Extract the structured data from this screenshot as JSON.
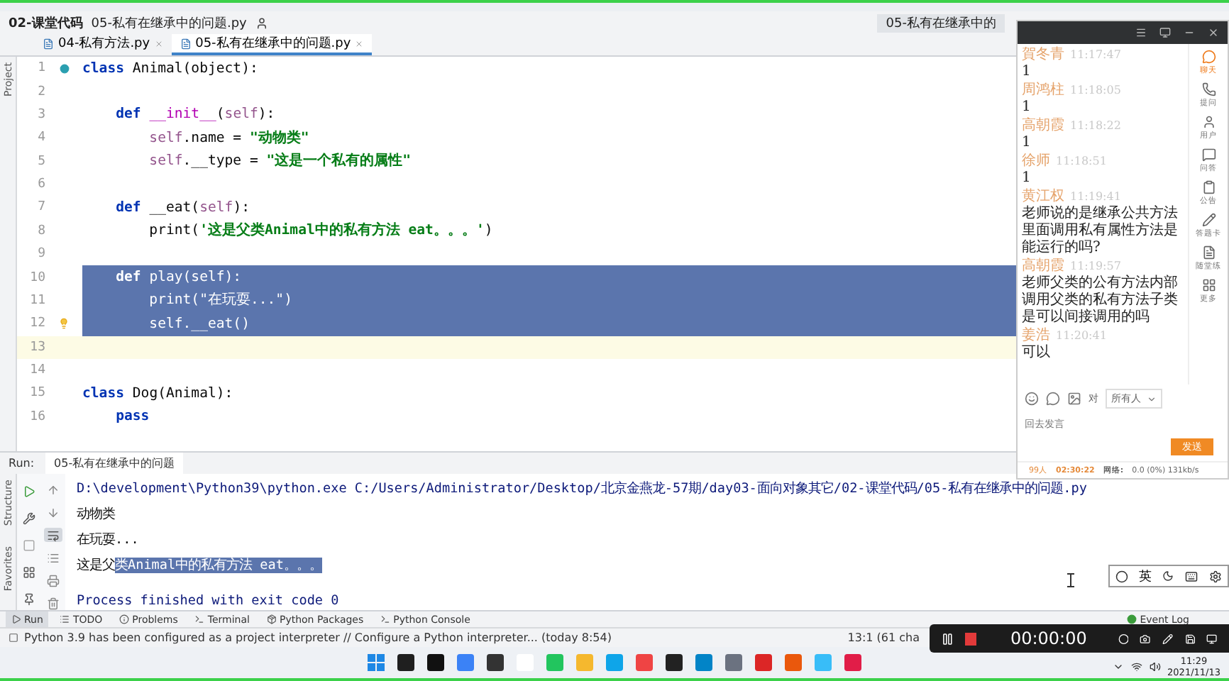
{
  "nav_bar": {
    "breadcrumb": [
      "02-课堂代码",
      "05-私有在继承中的问题.py"
    ],
    "run_config": "05-私有在继承中的"
  },
  "tabs": [
    {
      "label": "04-私有方法.py",
      "selected": false
    },
    {
      "label": "05-私有在继承中的问题.py",
      "selected": true
    }
  ],
  "side_label": "Project",
  "editor": {
    "lines": [
      {
        "number": "1",
        "marker": {
          "kind": "override"
        },
        "selected": false,
        "current": false,
        "tokens": [
          {
            "t": "class",
            "kind": "kw"
          },
          {
            "t": " Animal(object):",
            "kind": "plain"
          }
        ]
      },
      {
        "number": "2",
        "selected": false,
        "current": false
      },
      {
        "number": "3",
        "selected": false,
        "current": false,
        "tokens": [
          {
            "t": "    def",
            "kind": "kw"
          },
          {
            "t": " __init__",
            "kind": "magic"
          },
          {
            "t": "(",
            "kind": "plain"
          },
          {
            "t": "self",
            "kind": "self"
          },
          {
            "t": "):",
            "kind": "plain"
          }
        ]
      },
      {
        "number": "4",
        "selected": false,
        "current": false,
        "tokens": [
          {
            "t": "        self",
            "kind": "self"
          },
          {
            "t": ".name = ",
            "kind": "plain"
          },
          {
            "t": "\"动物类\"",
            "kind": "str"
          }
        ]
      },
      {
        "number": "5",
        "selected": false,
        "current": false,
        "tokens": [
          {
            "t": "        self",
            "kind": "self"
          },
          {
            "t": ".__type = ",
            "kind": "plain"
          },
          {
            "t": "\"这是一个私有的属性\"",
            "kind": "str"
          }
        ]
      },
      {
        "number": "6",
        "selected": false,
        "current": false
      },
      {
        "number": "7",
        "selected": false,
        "current": false,
        "tokens": [
          {
            "t": "    def",
            "kind": "kw"
          },
          {
            "t": " __eat(",
            "kind": "plain"
          },
          {
            "t": "self",
            "kind": "self"
          },
          {
            "t": "):",
            "kind": "plain"
          }
        ]
      },
      {
        "number": "8",
        "selected": false,
        "current": false,
        "tokens": [
          {
            "t": "        print(",
            "kind": "plain"
          },
          {
            "t": "'这是父类Animal中的私有方法 eat。。。'",
            "kind": "str"
          },
          {
            "t": ")",
            "kind": "plain"
          }
        ]
      },
      {
        "number": "9",
        "selected": false,
        "current": false
      },
      {
        "number": "10",
        "selected": true,
        "current": false,
        "tokens": [
          {
            "t": "    def",
            "kind": "kw"
          },
          {
            "t": " play(self):",
            "kind": "plain"
          }
        ]
      },
      {
        "number": "11",
        "selected": true,
        "current": false,
        "tokens": [
          {
            "t": "        print(\"在玩耍...\")",
            "kind": "plain"
          }
        ]
      },
      {
        "number": "12",
        "marker": {
          "kind": "bulb"
        },
        "selected": true,
        "current": false,
        "tokens": [
          {
            "t": "        self.__eat()",
            "kind": "plain"
          }
        ]
      },
      {
        "number": "13",
        "selected": false,
        "current": true
      },
      {
        "number": "14",
        "selected": false,
        "current": false
      },
      {
        "number": "15",
        "selected": false,
        "current": false,
        "tokens": [
          {
            "t": "class",
            "kind": "kw"
          },
          {
            "t": " Dog(Animal):",
            "kind": "plain"
          }
        ]
      },
      {
        "number": "16",
        "selected": false,
        "current": false,
        "tokens": [
          {
            "t": "    pass",
            "kind": "kw"
          }
        ]
      }
    ]
  },
  "run_panel": {
    "label": "Run:",
    "tab": "05-私有在继承中的问题",
    "side_labels": [
      "Structure",
      "Favorites"
    ],
    "soft_wrap_on": true,
    "lines": [
      {
        "kind": "command",
        "text": "D:\\development\\Python39\\python.exe C:/Users/Administrator/Desktop/北京金燕龙-57期/day03-面向对象其它/02-课堂代码/05-私有在继承中的问题.py"
      },
      {
        "kind": "output",
        "text": "动物类"
      },
      {
        "kind": "output",
        "text": "在玩耍..."
      },
      {
        "kind": "output",
        "text": "这是父",
        "selected_text": "类Animal中的私有方法 eat。。。"
      },
      {
        "kind": "exit",
        "text": "Process finished with exit code 0"
      }
    ]
  },
  "tool_tabs": [
    {
      "label": "Run",
      "selected": true
    },
    {
      "label": "TODO",
      "selected": false
    },
    {
      "label": "Problems",
      "selected": false
    },
    {
      "label": "Terminal",
      "selected": false
    },
    {
      "label": "Python Packages",
      "selected": false
    },
    {
      "label": "Python Console",
      "selected": false
    }
  ],
  "event_log": "Event Log",
  "status_bar": {
    "message": "Python 3.9 has been configured as a project interpreter // Configure a Python interpreter... (today 8:54)",
    "position": "13:1 (61 cha"
  },
  "taskbar": {
    "time": "11:29",
    "date": "2021/11/13"
  },
  "chat_panel": {
    "messages": [
      {
        "name": "賀冬青",
        "time": "11:17:47",
        "text": "1"
      },
      {
        "name": "周鸿柱",
        "time": "11:18:05",
        "text": "1"
      },
      {
        "name": "高朝霞",
        "time": "11:18:22",
        "text": "1"
      },
      {
        "name": "徐师",
        "time": "11:18:51",
        "text": "1"
      },
      {
        "name": "黄江权",
        "time": "11:19:41",
        "text": "老师说的是继承公共方法里面调用私有属性方法是能运行的吗?"
      },
      {
        "name": "高朝霞",
        "time": "11:19:57",
        "text": "老师父类的公有方法内部调用父类的私有方法子类是可以间接调用的吗"
      },
      {
        "name": "姜浩",
        "time": "11:20:41",
        "text": "可以"
      }
    ],
    "side_items": [
      {
        "label": "聊天",
        "selected": true
      },
      {
        "label": "提问",
        "selected": false
      },
      {
        "label": "用户",
        "selected": false
      },
      {
        "label": "问答",
        "selected": false
      },
      {
        "label": "公告",
        "selected": false
      },
      {
        "label": "答题卡",
        "selected": false
      },
      {
        "label": "随堂练",
        "selected": false
      },
      {
        "label": "更多",
        "selected": false
      }
    ],
    "to_label": "对",
    "recipient": "所有人",
    "placeholder": "回去发言",
    "send": "发送",
    "footer": {
      "count": "99人",
      "duration": "02:30:22",
      "network_label": "网络:",
      "network": "0.0 (0%) 131kb/s"
    }
  },
  "ime_bar": {
    "mode": "英"
  },
  "recorder": {
    "timer": "00:00:00"
  }
}
